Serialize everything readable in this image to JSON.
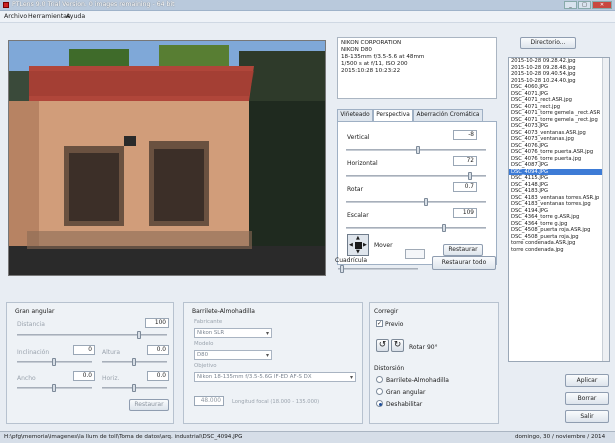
{
  "window": {
    "title": "PTLens 9.0 Trial Version. 0 images remaining - 64 bit"
  },
  "menu": [
    "Archivo",
    "Herramientas",
    "Ayuda"
  ],
  "exif": [
    "NIKON CORPORATION",
    "NIKON D80",
    "18-135mm f/3.5-5.6 at 48mm",
    "1/500 s at f/11, ISO 200",
    "2015:10:28 10:23:22"
  ],
  "directory_button": "Directorio...",
  "tabs": [
    "Viñeteado",
    "Perspectiva",
    "Aberración Cromática"
  ],
  "perspective": {
    "vertical_label": "Vertical",
    "vertical_value": "-8",
    "horizontal_label": "Horizontal",
    "horizontal_value": "72",
    "rotate_label": "Rotar",
    "rotate_value": "0.7",
    "scale_label": "Escalar",
    "scale_value": "109",
    "move_label": "Mover",
    "reset_label": "Restaurar"
  },
  "grid": {
    "label": "Cuadrícula",
    "reset_all": "Restaurar todo"
  },
  "files": [
    "2015-10-28 09.28.42.jpg",
    "2015-10-28 09.28.48.jpg",
    "2015-10-28 09.40.54.jpg",
    "2015-10-28 10.24.40.jpg",
    "DSC_4060.JPG",
    "DSC_4071.JPG",
    "DSC_4071_rect.ASR.jpg",
    "DSC_4071_rect.jpg",
    "DSC_4071_torre gemela _rect.ASR",
    "DSC_4071_torre gemela _rect.jpg",
    "DSC_4073.JPG",
    "DSC_4073_ventanas.ASR.jpg",
    "DSC_4073_ventanas.jpg",
    "DSC_4076.JPG",
    "DSC_4076_torre puerta.ASR.jpg",
    "DSC_4076_torre puerta.jpg",
    "DSC_4087.JPG",
    "DSC_4094.JPG",
    "DSC_4115.JPG",
    "DSC_4148.JPG",
    "DSC_4183.JPG",
    "DSC_4183_ventanas torres.ASR.jp",
    "DSC_4183_ventanas torres.jpg",
    "DSC_4194.JPG",
    "DSC_4364_torre g.ASR.jpg",
    "DSC_4364_torre g.jpg",
    "DSC_4508_puerta roja.ASR.jpg",
    "DSC_4508_puerta roja.jpg",
    "torre condenada.ASR.jpg",
    "torre condenada.jpg"
  ],
  "selected_file": "DSC_4094.JPG",
  "wide_angle": {
    "title": "Gran angular",
    "distance_label": "Distancia",
    "distance_value": "100",
    "slant_label": "Inclinación",
    "slant_value": "0",
    "height_label": "Altura",
    "height_value": "0.0",
    "width_label": "Ancho",
    "width_value": "0.0",
    "horiz_label": "Horiz.",
    "horiz_value": "0.0",
    "reset_label": "Restaurar"
  },
  "barrel": {
    "title": "Barrilete-Almohadilla",
    "maker_label": "Fabricante",
    "maker_value": "Nikon SLR",
    "model_label": "Modelo",
    "model_value": "D80",
    "lens_label": "Objetivo",
    "lens_value": "Nikon 18-135mm f/3.5-5.6G IF-ED AF-S DX",
    "focal_value": "48.000",
    "focal_label": "Longitud focal (18.000 - 135.000)"
  },
  "correct": {
    "title": "Corregir",
    "preview_label": "Previo",
    "preview_checked": true,
    "rotate90_label": "Rotar 90°",
    "distortion_title": "Distorsión",
    "options": [
      "Barrilete-Almohadilla",
      "Gran angular",
      "Deshabilitar"
    ],
    "selected_option": 2
  },
  "actions": {
    "apply": "Aplicar",
    "delete": "Borrar",
    "exit": "Salir"
  },
  "status": {
    "path": "H:\\pfg\\memoria\\imagenes\\la llum de toll\\Toma de datos\\arq. industrial\\DSC_4094.JPG",
    "date": "domingo, 30 / noviembre / 2014"
  },
  "colors": {
    "accent": "#3d7bd6",
    "title_bar": "#b9c9dc"
  }
}
